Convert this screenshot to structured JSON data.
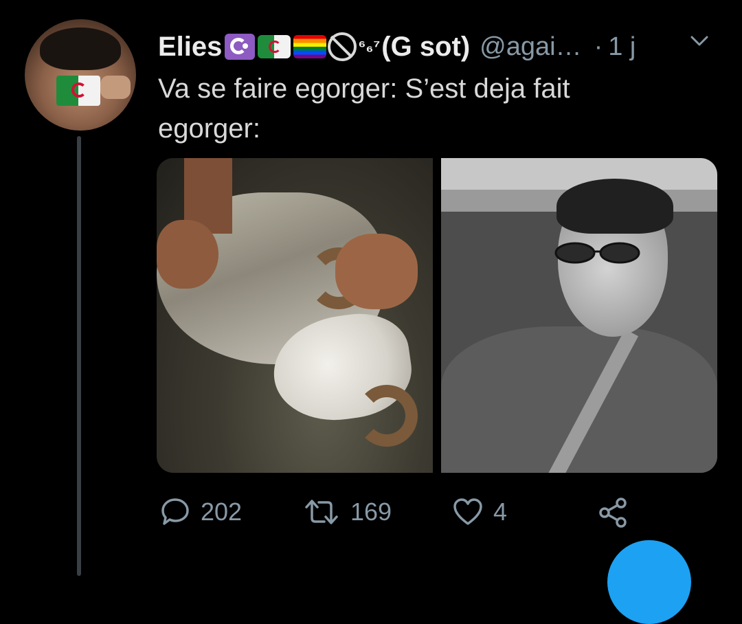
{
  "tweet": {
    "author": {
      "display_name": "Elies",
      "emoji_badges": [
        "star-and-crescent-emoji",
        "algeria-flag-emoji",
        "rainbow-flag-emoji",
        "prohibited-emoji"
      ],
      "sup_text": "⁶₆⁷",
      "display_name_suffix": "(G sot)",
      "handle": "@agai…"
    },
    "separator": "·",
    "time": "1 j",
    "text_line1": "Va se faire egorger: S’est deja fait",
    "text_line2": "egorger:",
    "media": [
      "sheep-photo",
      "man-photo"
    ],
    "actions": {
      "reply_count": "202",
      "retweet_count": "169",
      "like_count": "4"
    }
  },
  "colors": {
    "background": "#000000",
    "text": "#d9d9d9",
    "secondary_text": "#8899a6",
    "accent": "#1da1f2"
  }
}
